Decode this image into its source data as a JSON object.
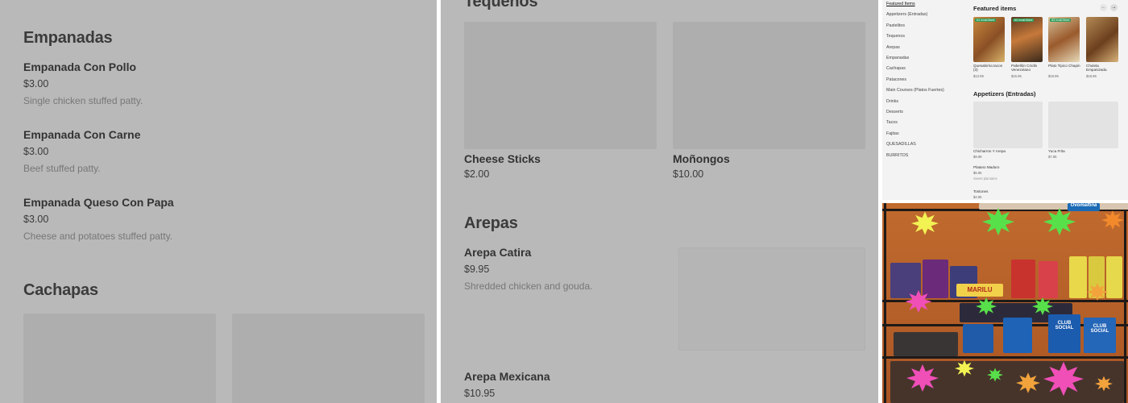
{
  "panel1": {
    "sections": [
      {
        "title": "Empanadas",
        "items": [
          {
            "name": "Empanada Con Pollo",
            "price": "$3.00",
            "desc": "Single chicken stuffed patty."
          },
          {
            "name": "Empanada Con Carne",
            "price": "$3.00",
            "desc": "Beef stuffed patty."
          },
          {
            "name": "Empanada Queso Con Papa",
            "price": "$3.00",
            "desc": "Cheese and potatoes stuffed patty."
          }
        ]
      },
      {
        "title": "Cachapas"
      }
    ]
  },
  "panel2": {
    "section_top": "Tequeños",
    "cards": [
      {
        "name": "Cheese Sticks",
        "price": "$2.00"
      },
      {
        "name": "Moñongos",
        "price": "$10.00"
      }
    ],
    "arepas": {
      "title": "Arepas",
      "items": [
        {
          "name": "Arepa Catira",
          "price": "$9.95",
          "desc": "Shredded chicken and gouda."
        },
        {
          "name": "Arepa Mexicana",
          "price": "$10.95"
        }
      ]
    }
  },
  "panel3": {
    "sidebar": [
      "Featured Items",
      "Appetizers (Entradas)",
      "Pastelitos",
      "Tequenos",
      "Arepas",
      "Empanadas",
      "Cachapas",
      "Patacones",
      "Main Courses (Platos Fuertes)",
      "Drinks",
      "Desserts",
      "Tacos",
      "Fajitas",
      "QUESADILLAS",
      "BURRITOS"
    ],
    "featured_title": "Featured items",
    "featured": [
      {
        "badge": "#1 most liked",
        "name": "Quesabirria tacos (3)",
        "price": "$13.99"
      },
      {
        "badge": "#2 most liked",
        "name": "Pabellón Criollo Venezolano",
        "price": "$15.95"
      },
      {
        "badge": "#3 most liked",
        "name": "Plato Tipico Chapin",
        "price": "$19.95"
      },
      {
        "badge": "",
        "name": "Chuleta Empanizada",
        "price": "$18.95"
      }
    ],
    "appetizers_title": "Appetizers (Entradas)",
    "appetizers": [
      {
        "name": "Chicharron Y Arepa",
        "price": "$9.99"
      },
      {
        "name": "Yuca Frita",
        "price": "$7.95"
      },
      {
        "name": "Platano Maduro",
        "price": "$5.95",
        "desc": "Sweet plantains"
      },
      {
        "name": "Tostones",
        "price": "$4.95"
      }
    ],
    "nav_prev": "←",
    "nav_next": "→"
  },
  "panel4": {
    "labels": [
      "MARILU",
      "CLUB SOCIAL",
      "CLUB SOCIAL",
      "Ovomaltina"
    ]
  },
  "colors": {
    "panel_overlay": "#b9b9b9",
    "badge_green": "#2c9d5a",
    "wall_orange": "#b5612a"
  }
}
